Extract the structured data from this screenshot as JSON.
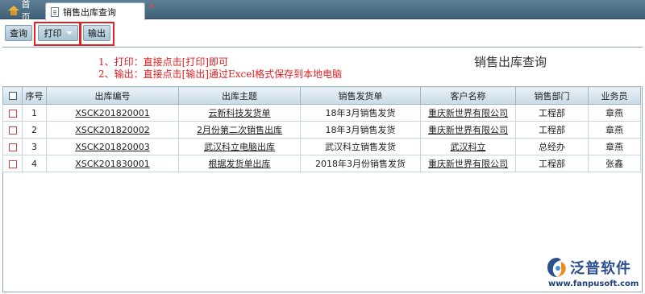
{
  "tabs": {
    "home": "首页",
    "active": "销售出库查询"
  },
  "toolbar": {
    "query_label": "查询",
    "print_label": "打印",
    "export_label": "输出"
  },
  "notes": {
    "line1": "1、打印：直接点击[打印]即可",
    "line2": "2、输出：直接点击[输出]通过Excel格式保存到本地电脑"
  },
  "page_title": "销售出库查询",
  "table": {
    "headers": [
      "序号",
      "出库编号",
      "出库主题",
      "销售发货单",
      "客户名称",
      "销售部门",
      "业务员"
    ],
    "rows": [
      {
        "no": "1",
        "code": "XSCK201820001",
        "subject": "云新科技发货单",
        "shipment": "18年3月销售发货",
        "customer": "重庆新世界有限公司",
        "dept": "工程部",
        "salesman": "章燕"
      },
      {
        "no": "2",
        "code": "XSCK201820002",
        "subject": "2月份第二次销售出库",
        "shipment": "18年3月销售发货",
        "customer": "重庆新世界有限公司",
        "dept": "工程部",
        "salesman": "章燕"
      },
      {
        "no": "3",
        "code": "XSCK201820003",
        "subject": "武汉科立电脑出库",
        "shipment": "武汉科立销售发货",
        "customer": "武汉科立",
        "dept": "总经办",
        "salesman": "章燕"
      },
      {
        "no": "4",
        "code": "XSCK201830001",
        "subject": "根据发货单出库",
        "shipment": "2018年3月份销售发货",
        "customer": "重庆新世界有限公司",
        "dept": "工程部",
        "salesman": "张鑫"
      }
    ]
  },
  "logo": {
    "name": "泛普软件",
    "url": "www.fanpusoft.com"
  },
  "colors": {
    "accent_red": "#e32222",
    "tab_bar": "#4d6f86",
    "logo_blue": "#2e4f8f"
  }
}
